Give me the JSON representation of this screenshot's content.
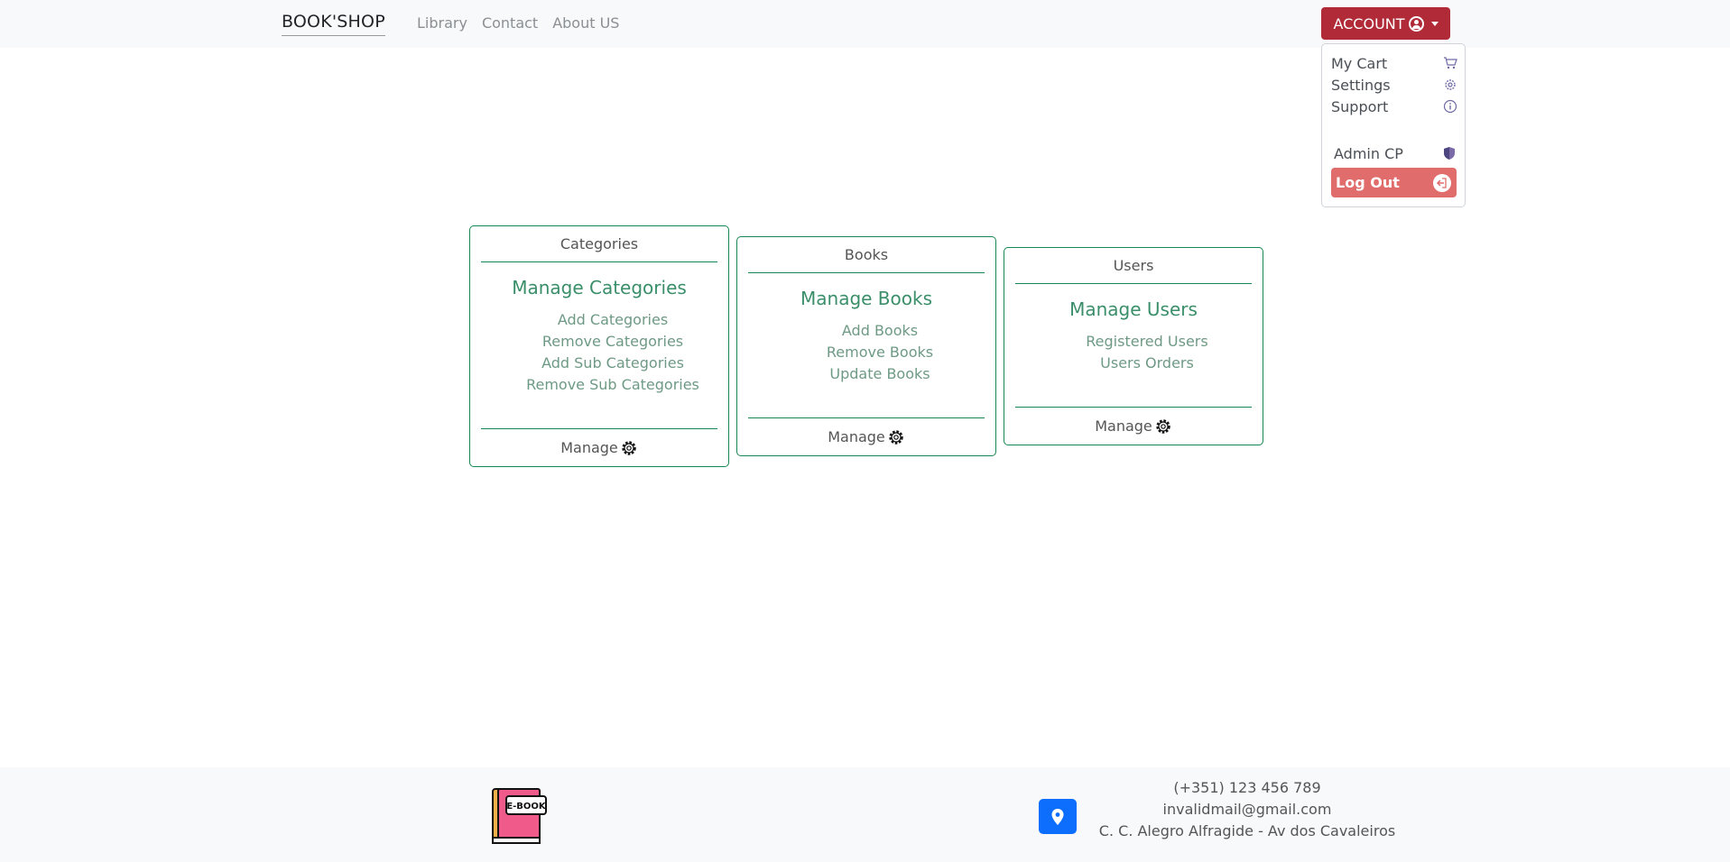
{
  "navbar": {
    "brand": "BOOK'SHOP",
    "links": [
      "Library",
      "Contact",
      "About US"
    ],
    "account_label": "ACCOUNT"
  },
  "dropdown": {
    "items": [
      "My Cart",
      "Settings",
      "Support",
      "Admin CP"
    ],
    "logout": "Log Out"
  },
  "cards": [
    {
      "header": "Categories",
      "title": "Manage Categories",
      "links": [
        "Add Categories",
        "Remove Categories",
        "Add Sub Categories",
        "Remove Sub Categories"
      ],
      "footer": "Manage"
    },
    {
      "header": "Books",
      "title": "Manage Books",
      "links": [
        "Add Books",
        "Remove Books",
        "Update Books"
      ],
      "footer": "Manage"
    },
    {
      "header": "Users",
      "title": "Manage Users",
      "links": [
        "Registered Users",
        "Users Orders"
      ],
      "footer": "Manage"
    }
  ],
  "footer": {
    "logo_text": "E-BOOK",
    "phone": "(+351) 123 456 789",
    "email": "invalidmail@gmail.com",
    "address": "C. C. Alegro Alfragide - Av dos Cavaleiros"
  },
  "colors": {
    "account": "#b02a37",
    "logout": "#e06c6c",
    "card_border": "#198754",
    "location": "#0d6efd"
  }
}
